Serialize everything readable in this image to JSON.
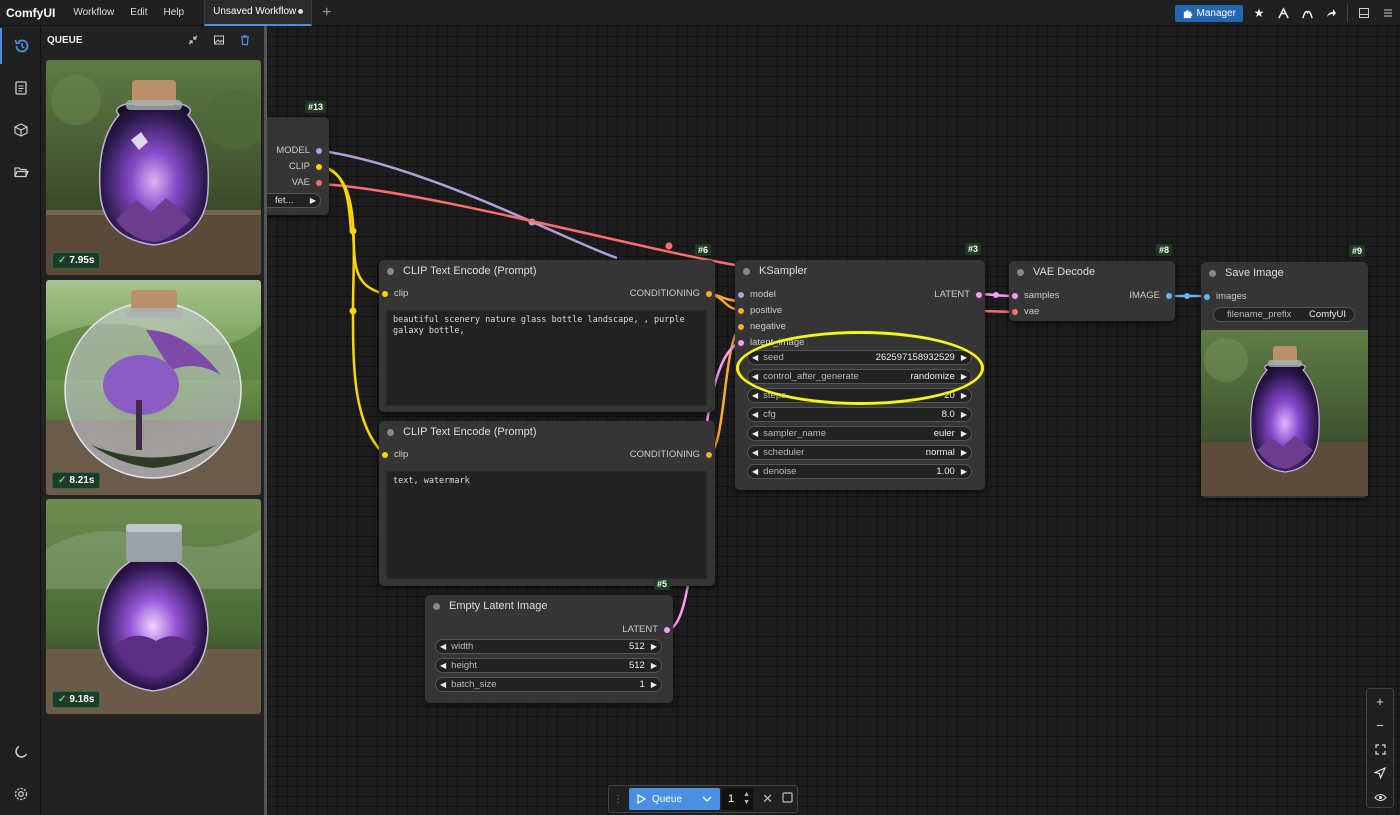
{
  "app": {
    "name": "ComfyUI",
    "menu": [
      "Workflow",
      "Edit",
      "Help"
    ],
    "tab_label": "Unsaved Workflow"
  },
  "toolbar": {
    "manager_label": "Manager"
  },
  "queue_panel": {
    "title": "QUEUE",
    "items": [
      {
        "time": "7.95s"
      },
      {
        "time": "8.21s"
      },
      {
        "time": "9.18s"
      }
    ]
  },
  "nodes": {
    "checkpoint": {
      "id": "#13",
      "outputs": [
        "MODEL",
        "CLIP",
        "VAE"
      ],
      "widget_value": "fet..."
    },
    "clip_positive": {
      "id": "#6",
      "title": "CLIP Text Encode (Prompt)",
      "input": "clip",
      "output": "CONDITIONING",
      "text": "beautiful scenery nature glass bottle landscape, , purple galaxy bottle,"
    },
    "clip_negative": {
      "id": "",
      "title": "CLIP Text Encode (Prompt)",
      "input": "clip",
      "output": "CONDITIONING",
      "text": "text, watermark"
    },
    "ksampler": {
      "id": "#3",
      "title": "KSampler",
      "inputs": [
        "model",
        "positive",
        "negative",
        "latent_image"
      ],
      "output": "LATENT",
      "widgets": [
        {
          "label": "seed",
          "value": "262597158932529"
        },
        {
          "label": "control_after_generate",
          "value": "randomize"
        },
        {
          "label": "steps",
          "value": "20"
        },
        {
          "label": "cfg",
          "value": "8.0"
        },
        {
          "label": "sampler_name",
          "value": "euler"
        },
        {
          "label": "scheduler",
          "value": "normal"
        },
        {
          "label": "denoise",
          "value": "1.00"
        }
      ]
    },
    "vae_decode": {
      "id": "#8",
      "title": "VAE Decode",
      "inputs": [
        "samples",
        "vae"
      ],
      "output": "IMAGE"
    },
    "save_image": {
      "id": "#9",
      "title": "Save Image",
      "input": "images",
      "widget_label": "filename_prefix",
      "widget_value": "ComfyUI"
    },
    "empty_latent": {
      "id": "#5",
      "title": "Empty Latent Image",
      "output": "LATENT",
      "widgets": [
        {
          "label": "width",
          "value": "512"
        },
        {
          "label": "height",
          "value": "512"
        },
        {
          "label": "batch_size",
          "value": "1"
        }
      ]
    }
  },
  "queue_bar": {
    "button_label": "Queue",
    "count": "1"
  },
  "colors": {
    "model": "#b39ddb",
    "clip": "#ffd500",
    "vae": "#ff6e6e",
    "conditioning": "#ffa931",
    "latent": "#ff9cf9",
    "image": "#64b5f6",
    "accent": "#4a90e2",
    "highlight": "#f5f516"
  },
  "icons": [
    "history-icon",
    "document-icon",
    "cube-icon",
    "folder-icon",
    "moon-icon",
    "gear-icon",
    "puzzle-icon",
    "star-icon",
    "share-icon"
  ]
}
